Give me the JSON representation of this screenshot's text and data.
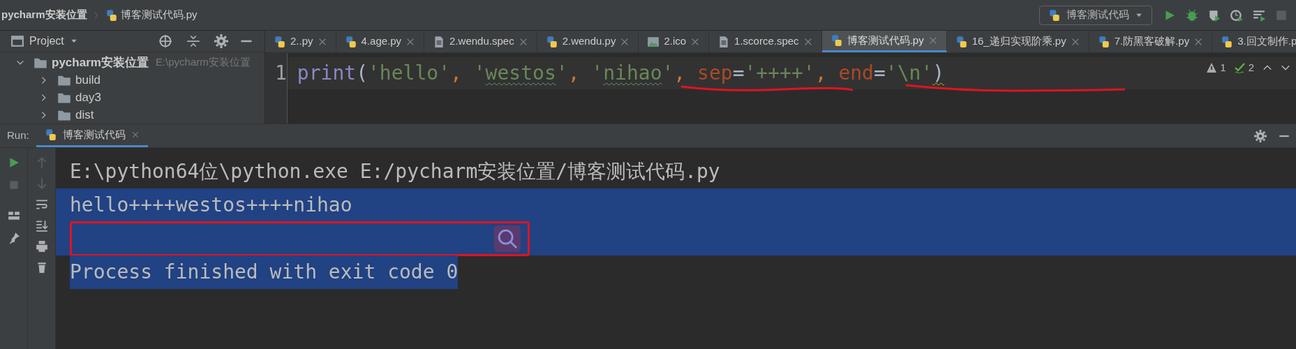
{
  "breadcrumb": [
    "pycharm安装位置",
    "博客测试代码.py"
  ],
  "run_config": {
    "label": "博客测试代码"
  },
  "project_panel": {
    "title": "Project",
    "tree": [
      {
        "label": "pycharm安装位置",
        "path": "E:\\pycharm安装位置",
        "expanded": true,
        "children": [
          {
            "label": "build",
            "expanded": false
          },
          {
            "label": "day3",
            "expanded": false
          },
          {
            "label": "dist",
            "expanded": false
          }
        ]
      }
    ]
  },
  "editor_tabs": [
    {
      "label": "2..py",
      "kind": "python",
      "selected": false
    },
    {
      "label": "4.age.py",
      "kind": "python",
      "selected": false
    },
    {
      "label": "2.wendu.spec",
      "kind": "text",
      "selected": false
    },
    {
      "label": "2.wendu.py",
      "kind": "python",
      "selected": false
    },
    {
      "label": "2.ico",
      "kind": "image",
      "selected": false
    },
    {
      "label": "1.scorce.spec",
      "kind": "text",
      "selected": false
    },
    {
      "label": "博客测试代码.py",
      "kind": "python",
      "selected": true
    },
    {
      "label": "16_递归实现阶乘.py",
      "kind": "python",
      "selected": false
    },
    {
      "label": "7.防黑客破解.py",
      "kind": "python",
      "selected": false
    },
    {
      "label": "3.回文制作.p",
      "kind": "python",
      "selected": false
    }
  ],
  "editor": {
    "lines": [
      {
        "number": "1",
        "tokens": [
          {
            "kind": "func",
            "text": "print"
          },
          {
            "kind": "paren",
            "text": "("
          },
          {
            "kind": "str",
            "text": "'hello'"
          },
          {
            "kind": "punct",
            "text": ", "
          },
          {
            "kind": "str",
            "text": "'"
          },
          {
            "kind": "str",
            "text": "westos",
            "typo": true
          },
          {
            "kind": "str",
            "text": "'"
          },
          {
            "kind": "punct",
            "text": ", "
          },
          {
            "kind": "str",
            "text": "'"
          },
          {
            "kind": "str",
            "text": "nihao",
            "typo": true
          },
          {
            "kind": "str",
            "text": "'"
          },
          {
            "kind": "punct",
            "text": ", "
          },
          {
            "kind": "param",
            "text": "sep"
          },
          {
            "kind": "paren",
            "text": "="
          },
          {
            "kind": "str",
            "text": "'++++'"
          },
          {
            "kind": "punct",
            "text": ", "
          },
          {
            "kind": "param",
            "text": "end"
          },
          {
            "kind": "paren",
            "text": "="
          },
          {
            "kind": "str",
            "text": "'\\n'"
          },
          {
            "kind": "paren",
            "text": ")",
            "warning": true
          }
        ]
      }
    ],
    "inspections": {
      "warnings": "1",
      "typos": "2"
    }
  },
  "run_panel": {
    "title": "Run:",
    "tab": {
      "label": "博客测试代码",
      "selected": true
    },
    "console": [
      {
        "text": "E:\\python64位\\python.exe E:/pycharm安装位置/博客测试代码.py",
        "selected": false
      },
      {
        "text": "hello++++westos++++nihao",
        "selected": true
      },
      {
        "selected": true
      },
      {
        "text": "Process finished with exit code 0",
        "selected": true
      }
    ]
  }
}
